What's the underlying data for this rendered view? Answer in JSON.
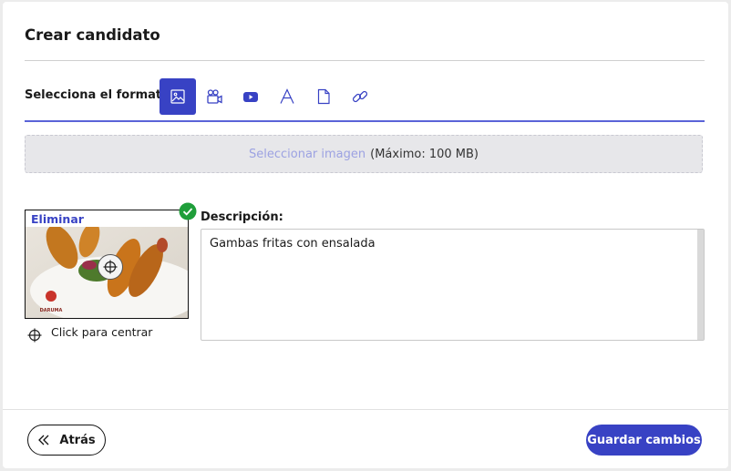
{
  "modal": {
    "title": "Crear candidato"
  },
  "format": {
    "label": "Selecciona el formato:",
    "tabs": [
      {
        "icon": "image-icon",
        "active": true
      },
      {
        "icon": "video-camera-icon",
        "active": false
      },
      {
        "icon": "youtube-icon",
        "active": false
      },
      {
        "icon": "text-icon",
        "active": false
      },
      {
        "icon": "document-icon",
        "active": false
      },
      {
        "icon": "link-icon",
        "active": false
      }
    ]
  },
  "upload": {
    "link_text": "Seleccionar imagen",
    "limit_text": "(Máximo: 100 MB)"
  },
  "image": {
    "delete_label": "Eliminar",
    "center_hint": "Click para centrar",
    "logo_text": "DARUMA"
  },
  "description": {
    "label": "Descripción:",
    "value": "Gambas fritas con ensalada"
  },
  "footer": {
    "back_label": "Atrás",
    "save_label": "Guardar cambios"
  },
  "colors": {
    "accent": "#3842c4",
    "success": "#1f9e3a"
  }
}
